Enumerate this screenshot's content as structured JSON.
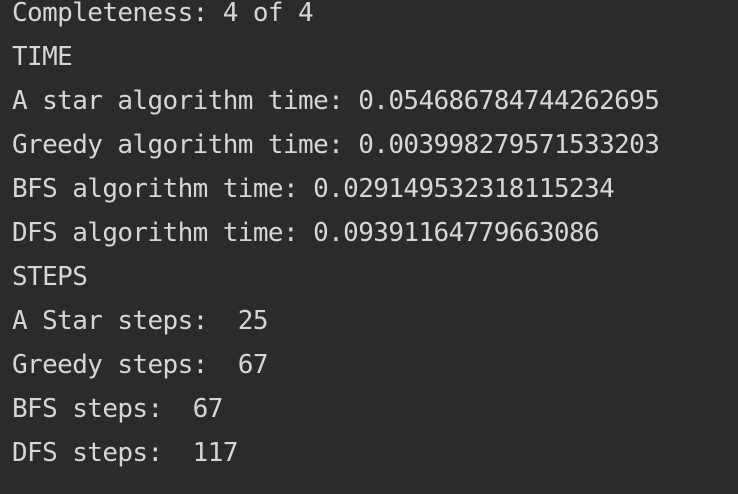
{
  "console": {
    "lines": [
      "Completeness: 4 of 4",
      "TIME",
      "A star algorithm time: 0.05468678474426269​5",
      "Greedy algorithm time: 0.003998279571533203",
      "BFS algorithm time: 0.029149532318115234",
      "DFS algorithm time: 0.09391164779663086",
      "STEPS",
      "A Star steps:  25",
      "Greedy steps:  67",
      "BFS steps:  67",
      "DFS steps:  117"
    ]
  },
  "colors": {
    "background": "#2b2b2b",
    "text": "#d6d6d6"
  }
}
